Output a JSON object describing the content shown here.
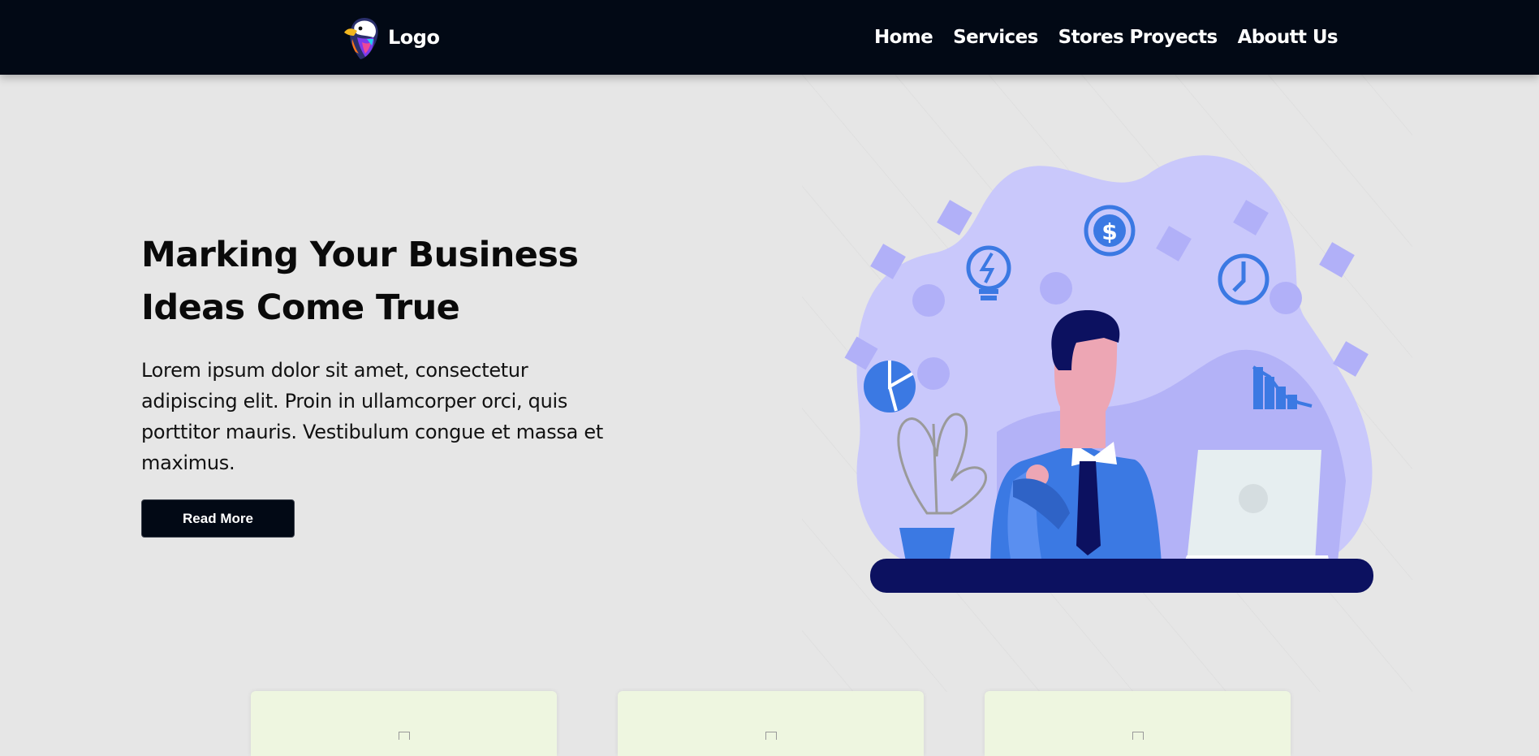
{
  "navbar": {
    "brand": {
      "logo_icon": "eagle-logo-icon",
      "text": "Logo"
    },
    "links": [
      "Home",
      "Services",
      "Stores Proyects",
      "Aboutt Us"
    ]
  },
  "hero": {
    "title_line1": "Marking Your Business",
    "title_line2": "Ideas Come True",
    "text": "Lorem ipsum dolor sit amet, consectetur adipiscing elit. Proin in ullamcorper orci, quis porttitor mauris. Vestibulum congue et massa et maximus.",
    "button_label": "Read More",
    "illustration": {
      "icon": "businessman-at-laptop-illustration",
      "watermark": "pngtree"
    }
  },
  "cards": [
    {
      "image_icon": "broken-image-icon"
    },
    {
      "image_icon": "broken-image-icon"
    },
    {
      "image_icon": "broken-image-icon"
    }
  ],
  "colors": {
    "navbar_bg": "#020915",
    "page_bg": "#e6e6e6",
    "button_bg": "#020915",
    "card_bg": "#eef6e0",
    "illustration_blob": "#c9c8fb",
    "illustration_accent": "#3b79e3",
    "desk": "#0c1160"
  }
}
